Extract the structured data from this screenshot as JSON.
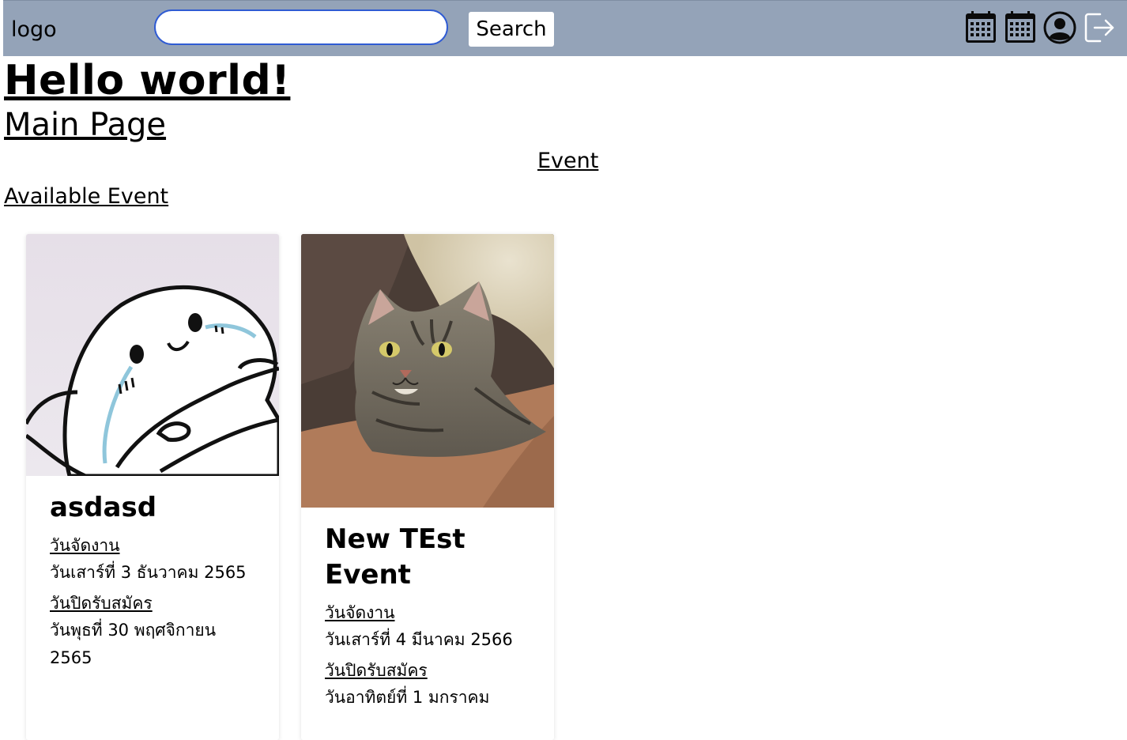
{
  "navbar": {
    "logo": "logo",
    "search": {
      "value": "",
      "placeholder": ""
    },
    "search_button": "Search",
    "icons": [
      "calendar-icon",
      "calendar-icon",
      "user-profile-icon",
      "logout-icon"
    ],
    "background": "#94a3b8"
  },
  "heading": "Hello world!",
  "main_page_link": "Main Page",
  "event_link": "Event",
  "available_event_link": "Available Event",
  "events": [
    {
      "title": "asdasd",
      "event_date_label": "วันจัดงาน",
      "event_date": "วันเสาร์ที่ 3 ธันวาคม 2565",
      "close_date_label": "วันปิดรับสมัคร",
      "close_date": "วันพุธที่ 30 พฤศจิกายน 2565"
    },
    {
      "title": "New TEst Event",
      "event_date_label": "วันจัดงาน",
      "event_date": "วันเสาร์ที่ 4 มีนาคม 2566",
      "close_date_label": "วันปิดรับสมัคร",
      "close_date": "วันอาทิตย์ที่ 1 มกราคม"
    }
  ]
}
